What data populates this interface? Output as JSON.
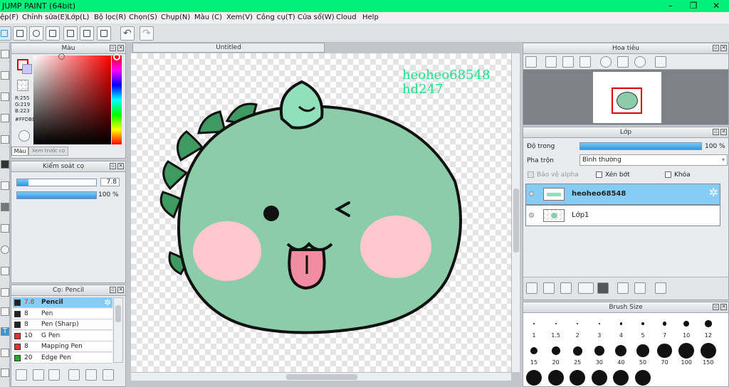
{
  "app": {
    "title": "JUMP PAINT (64bit)"
  },
  "window_controls": {
    "minimize": "–",
    "restore": "❐",
    "close": "✕"
  },
  "menu": [
    "ệp(F)",
    "Chỉnh sửa(E)",
    "Lớp(L)",
    "Bộ lọc(R)",
    "Chọn(S)",
    "Chụp(N)",
    "Màu (C)",
    "Xem(V)",
    "Công cụ(T)",
    "Cửa sổ(W)",
    "Cloud",
    "Help"
  ],
  "color_panel": {
    "title": "Màu",
    "r": "R:255",
    "g": "G:219",
    "b": "B:223",
    "hex": "#FFDBDF",
    "tab_active": "Màu",
    "tab_other": "Xem trước cọ",
    "fg_color": "#ff0000",
    "bg_color": "#c8c8ff"
  },
  "brush_control": {
    "title": "Kiểm soát cọ",
    "size": "7.8",
    "opacity": "100 %",
    "size_fraction": 0.14,
    "opacity_fraction": 1.0
  },
  "brush_list": {
    "title": "Cọ: Pencil",
    "items": [
      {
        "size": "7.8",
        "name": "Pencil",
        "color": "#222222",
        "selected": true
      },
      {
        "size": "8",
        "name": "Pen",
        "color": "#222222"
      },
      {
        "size": "8",
        "name": "Pen (Sharp)",
        "color": "#222222"
      },
      {
        "size": "10",
        "name": "G Pen",
        "color": "#dd3333"
      },
      {
        "size": "8",
        "name": "Mapping Pen",
        "color": "#dd3333"
      },
      {
        "size": "20",
        "name": "Edge Pen",
        "color": "#22aa33"
      }
    ]
  },
  "canvas": {
    "tab_title": "Untitled",
    "watermark1": "heoheo68548",
    "watermark2": "hd247"
  },
  "navigator": {
    "title": "Hoa tiêu"
  },
  "layer_panel": {
    "title": "Lớp",
    "opacity_label": "Độ trong",
    "opacity_value": "100 %",
    "opacity_fraction": 1.0,
    "blend_label": "Pha trộn",
    "blend_value": "Bình thường",
    "protect_alpha": "Bảo vệ alpha",
    "clipping": "Xén bớt",
    "lock": "Khóa",
    "layers": [
      {
        "name": "heoheo68548",
        "selected": true
      },
      {
        "name": "Lớp1",
        "selected": false
      }
    ]
  },
  "brush_size": {
    "title": "Brush Size",
    "row1": [
      "1",
      "1.5",
      "2",
      "3",
      "4",
      "5",
      "7",
      "10",
      "12"
    ],
    "row2": [
      "15",
      "20",
      "25",
      "30",
      "40",
      "50",
      "70",
      "100",
      "150"
    ]
  },
  "colors": {
    "accent": "#2e97e0",
    "title_bar": "#00f07a",
    "selected_row": "#86cdf5",
    "dino": "#8ccda9"
  }
}
